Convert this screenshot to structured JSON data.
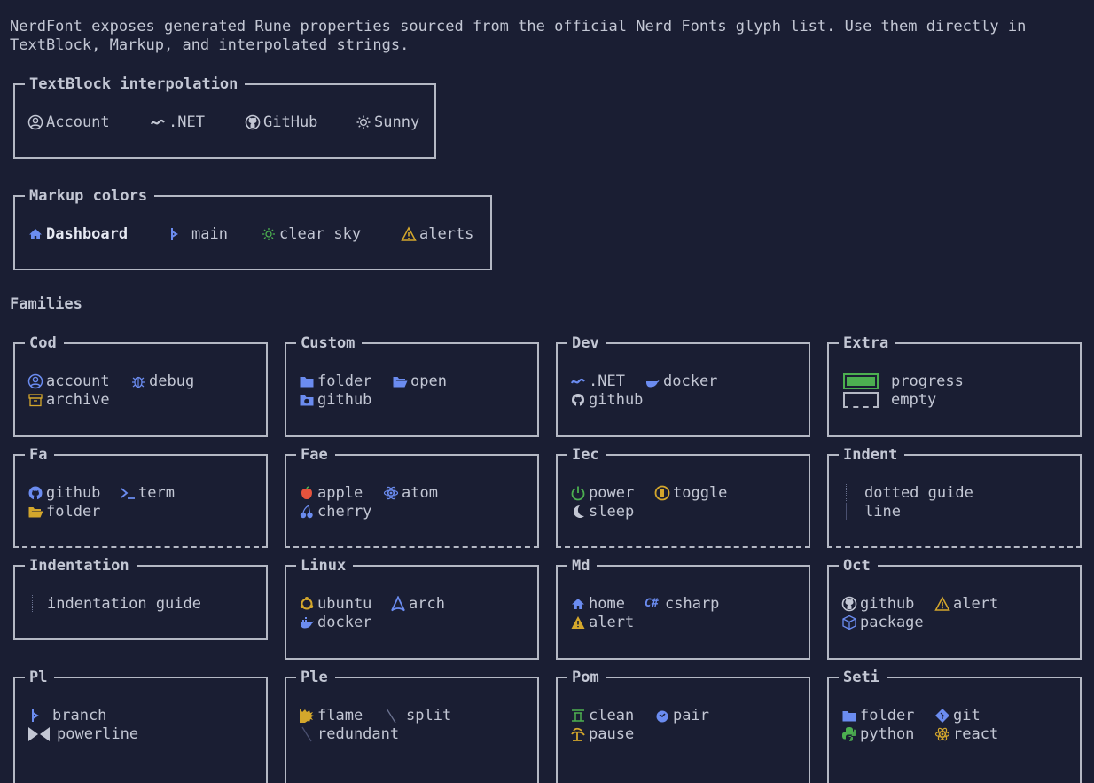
{
  "intro": {
    "line1": "NerdFont exposes generated Rune properties sourced from the official Nerd Fonts glyph list. Use them directly in",
    "line2": "TextBlock, Markup, and interpolated strings."
  },
  "textblock": {
    "title": "TextBlock interpolation",
    "items": [
      "Account",
      ".NET",
      "GitHub",
      "Sunny"
    ]
  },
  "markup": {
    "title": "Markup colors",
    "items": [
      "Dashboard",
      "main",
      "clear sky",
      "alerts"
    ]
  },
  "families_title": "Families",
  "families": {
    "cod": {
      "title": "Cod",
      "items": [
        "account",
        "debug",
        "archive"
      ]
    },
    "custom": {
      "title": "Custom",
      "items": [
        "folder",
        "open",
        "github"
      ]
    },
    "dev": {
      "title": "Dev",
      "items": [
        ".NET",
        "docker",
        "github"
      ]
    },
    "extra": {
      "title": "Extra",
      "items": [
        "progress",
        "empty"
      ]
    },
    "fa": {
      "title": "Fa",
      "items": [
        "github",
        "term",
        "folder"
      ]
    },
    "fae": {
      "title": "Fae",
      "items": [
        "apple",
        "atom",
        "cherry"
      ]
    },
    "iec": {
      "title": "Iec",
      "items": [
        "power",
        "toggle",
        "sleep"
      ]
    },
    "indent": {
      "title": "Indent",
      "items": [
        "dotted guide",
        "line"
      ]
    },
    "indentation": {
      "title": "Indentation",
      "items": [
        "indentation guide"
      ]
    },
    "linux": {
      "title": "Linux",
      "items": [
        "ubuntu",
        "arch",
        "docker"
      ]
    },
    "md": {
      "title": "Md",
      "items": [
        "home",
        "csharp",
        "alert"
      ]
    },
    "oct": {
      "title": "Oct",
      "items": [
        "github",
        "alert",
        "package"
      ]
    },
    "pl": {
      "title": "Pl",
      "items": [
        "branch",
        "powerline"
      ]
    },
    "ple": {
      "title": "Ple",
      "items": [
        "flame",
        "split",
        "redundant"
      ]
    },
    "pom": {
      "title": "Pom",
      "items": [
        "clean",
        "pair",
        "pause"
      ]
    },
    "seti": {
      "title": "Seti",
      "items": [
        "folder",
        "git",
        "python",
        "react"
      ]
    }
  },
  "colors": {
    "background": "#1a1e33",
    "text": "#c3c7d4",
    "border": "#b4b8c4",
    "blue": "#6b8cf0",
    "green": "#4caf50",
    "yellow": "#d4a72c",
    "red": "#e5533d"
  }
}
